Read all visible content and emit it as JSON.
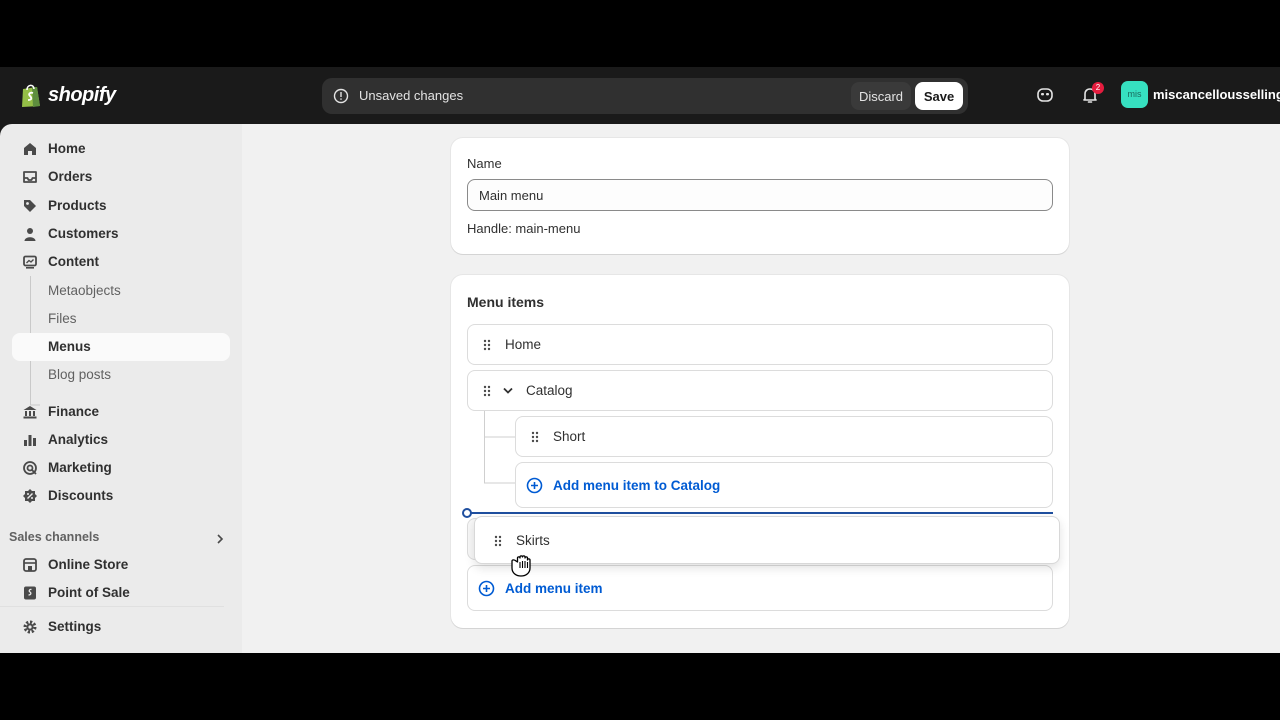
{
  "topbar": {
    "brand": "shopify",
    "unsaved_text": "Unsaved changes",
    "discard_label": "Discard",
    "save_label": "Save",
    "notification_count": "2",
    "avatar_initials": "mis",
    "store_name": "miscancellousselling"
  },
  "sidebar": {
    "items": [
      {
        "label": "Home",
        "icon": "home-icon"
      },
      {
        "label": "Orders",
        "icon": "inbox-icon"
      },
      {
        "label": "Products",
        "icon": "tag-icon"
      },
      {
        "label": "Customers",
        "icon": "person-icon"
      },
      {
        "label": "Content",
        "icon": "content-icon"
      }
    ],
    "content_sub": [
      "Metaobjects",
      "Files",
      "Menus",
      "Blog posts"
    ],
    "active": "Menus",
    "items2": [
      {
        "label": "Finance",
        "icon": "bank-icon"
      },
      {
        "label": "Analytics",
        "icon": "bar-chart-icon"
      },
      {
        "label": "Marketing",
        "icon": "target-icon"
      },
      {
        "label": "Discounts",
        "icon": "discount-icon"
      }
    ],
    "sales_channels_title": "Sales channels",
    "channels": [
      {
        "label": "Online Store",
        "icon": "store-icon"
      },
      {
        "label": "Point of Sale",
        "icon": "pos-icon"
      }
    ],
    "settings_label": "Settings"
  },
  "name_card": {
    "name_label": "Name",
    "name_value": "Main menu",
    "handle_text": "Handle: main-menu"
  },
  "menu_card": {
    "title": "Menu items",
    "rows": {
      "home": "Home",
      "catalog": "Catalog",
      "short": "Short",
      "add_to_catalog": "Add menu item to Catalog",
      "dragged": "Skirts",
      "add_menu_item": "Add menu item"
    }
  },
  "colors": {
    "topbar_bg": "#1a1a1a",
    "accent_link": "#005bd3",
    "drop_indicator": "#1f4f9f",
    "avatar_bg": "#36e0c0",
    "badge": "#e51c3e"
  }
}
